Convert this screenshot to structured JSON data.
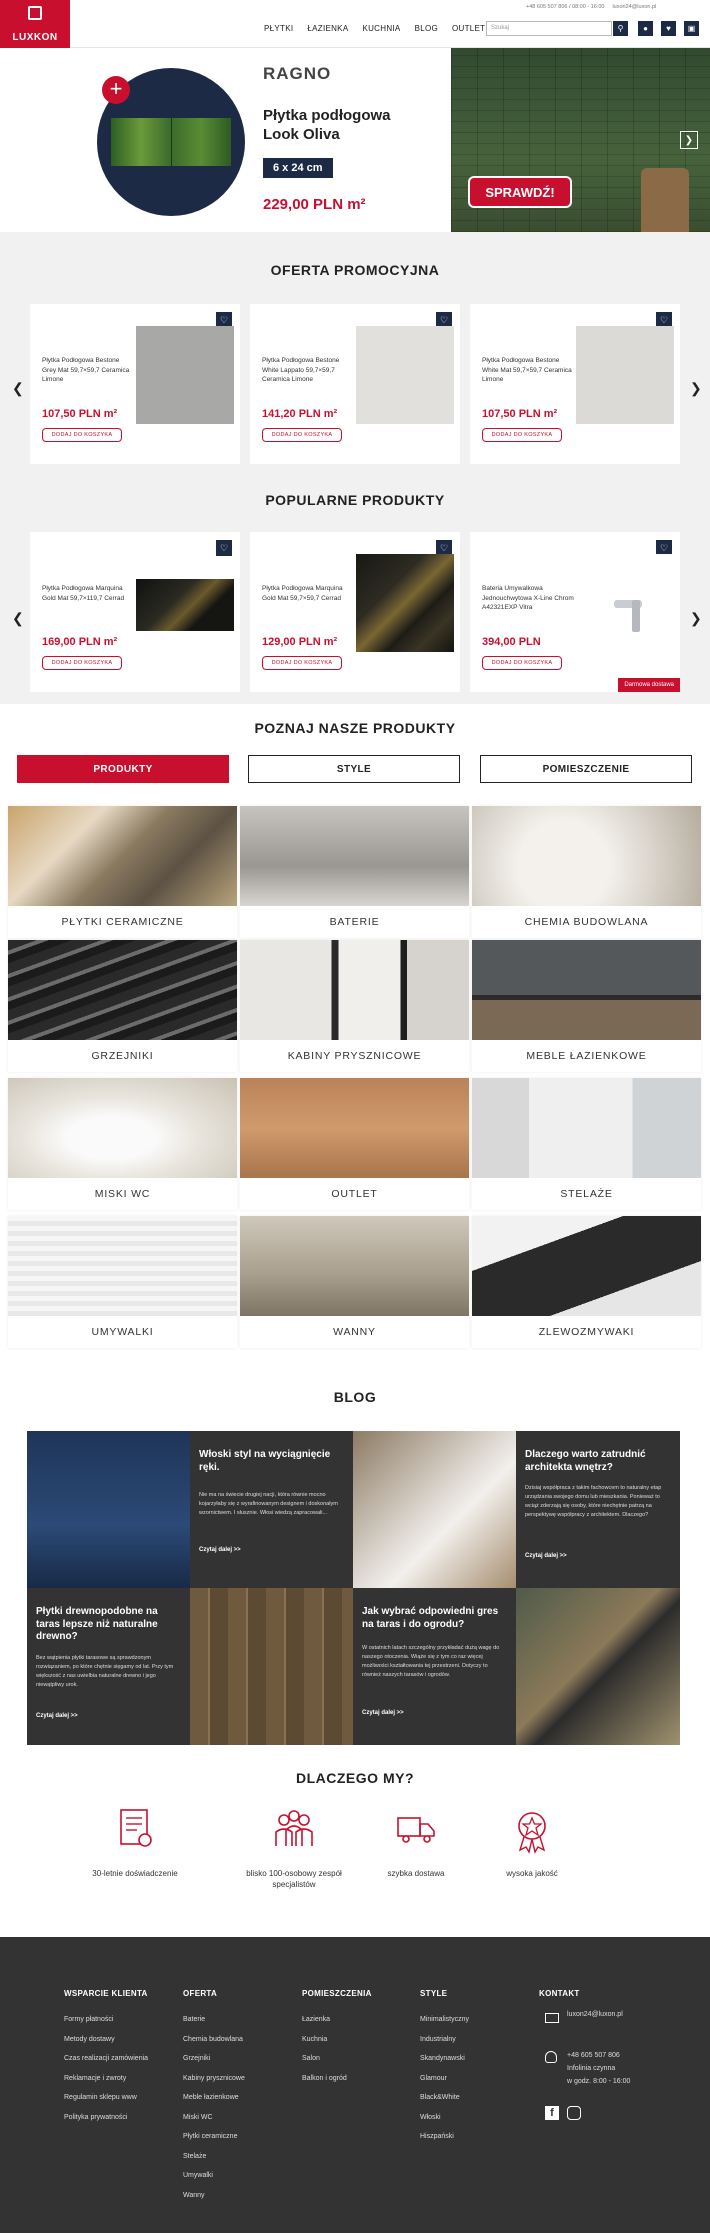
{
  "header": {
    "logo": "LUXKON",
    "nav": [
      "PŁYTKI",
      "ŁAZIENKA",
      "KUCHNIA",
      "BLOG",
      "OUTLET"
    ],
    "contact_phone": "+48 605 507 806 / 08:00 - 16:00",
    "contact_email": "luxon24@luxon.pl",
    "search_placeholder": "Szukaj"
  },
  "hero": {
    "brand": "RAGNO",
    "title": "Płytka podłogowa Look Oliva",
    "size": "6 x 24 cm",
    "price": "229,00 PLN m²",
    "cta": "SPRAWDŹ!"
  },
  "promo": {
    "title": "OFERTA PROMOCYJNA",
    "add_label": "DODAJ DO KOSZYKA",
    "items": [
      {
        "name": "Płytka Podłogowa Bestone Grey Mat 59,7×59,7 Ceramica Limone",
        "price": "107,50 PLN m²"
      },
      {
        "name": "Płytka Podłogowa Bestone White Lappato 59,7×59,7 Ceramica Limone",
        "price": "141,20 PLN m²"
      },
      {
        "name": "Płytka Podłogowa Bestone White Mat 59,7×59,7 Ceramica Limone",
        "price": "107,50 PLN m²"
      }
    ]
  },
  "popular": {
    "title": "POPULARNE PRODUKTY",
    "add_label": "DODAJ DO KOSZYKA",
    "badge": "Darmowa dostawa",
    "items": [
      {
        "name": "Płytka Podłogowa Marquina Gold Mat 59,7×119,7 Cerrad",
        "price": "169,00 PLN m²"
      },
      {
        "name": "Płytka Podłogowa Marquina Gold Mat 59,7×59,7 Cerrad",
        "price": "129,00 PLN m²"
      },
      {
        "name": "Bateria Umywalkowa Jednouchwytowa X-Line Chrom A42321EXP Vitra",
        "price": "394,00 PLN"
      }
    ]
  },
  "know": {
    "title": "POZNAJ NASZE PRODUKTY",
    "tabs": [
      "PRODUKTY",
      "STYLE",
      "POMIESZCZENIE"
    ],
    "categories": [
      "PŁYTKI CERAMICZNE",
      "BATERIE",
      "CHEMIA BUDOWLANA",
      "GRZEJNIKI",
      "KABINY PRYSZNICOWE",
      "MEBLE ŁAZIENKOWE",
      "MISKI WC",
      "OUTLET",
      "STELAŻE",
      "UMYWALKI",
      "WANNY",
      "ZLEWOZMYWAKI"
    ]
  },
  "blog": {
    "title": "BLOG",
    "more": "Czytaj dalej >>",
    "posts": [
      {
        "title": "Włoski styl na wyciągnięcie ręki.",
        "desc": "Nie ma na świecie drugiej nacji, która równie mocno kojarzyłaby się z wyrafinowanym designem i doskonałym wzornictwem. I słusznie. Włosi wiedzą zapracowali..."
      },
      {
        "title": "Dlaczego warto zatrudnić architekta wnętrz?",
        "desc": "Dzisiaj współpraca z takim fachowcem to naturalny etap urządzania swojego domu lub mieszkania. Ponieważ to wciąż zderzają się osoby, które niechętnie patrzą na perspektywę współpracy z architektem. Dlaczego?"
      },
      {
        "title": "Płytki drewnopodobne na taras lepsze niż naturalne drewno?",
        "desc": "Bez wątpienia płytki tarasowe są sprawdzonym rozwiązaniem, po które chętnie sięgamy od lat. Przy tym większość z nas uwielbia naturalne drewno i jego niewątpliwy urok."
      },
      {
        "title": "Jak wybrać odpowiedni gres na taras i do ogrodu?",
        "desc": "W ostatnich latach szczególny przykładać dużą wagę do naszego otoczenia. Wiąże się z tym co raz więcej możliwości kształtowania tej przestrzeni. Dotyczy to również naszych tarasów i ogrodów."
      }
    ]
  },
  "why": {
    "title": "DLACZEGO MY?",
    "items": [
      "30-letnie doświadczenie",
      "blisko 100-osobowy zespół specjalistów",
      "szybka dostawa",
      "wysoka jakość"
    ]
  },
  "footer": {
    "cols": [
      {
        "title": "WSPARCIE KLIENTA",
        "items": [
          "Formy płatności",
          "Metody dostawy",
          "Czas realizacji zamówienia",
          "Reklamacje i zwroty",
          "Regulamin sklepu www",
          "Polityka prywatności"
        ]
      },
      {
        "title": "OFERTA",
        "items": [
          "Baterie",
          "Chemia budowlana",
          "Grzejniki",
          "Kabiny prysznicowe",
          "Meble łazienkowe",
          "Miski WC",
          "Płytki ceramiczne",
          "Stelaże",
          "Umywalki",
          "Wanny"
        ]
      },
      {
        "title": "POMIESZCZENIA",
        "items": [
          "Łazienka",
          "Kuchnia",
          "Salon",
          "Balkon i ogród"
        ]
      },
      {
        "title": "STYLE",
        "items": [
          "Minimalistyczny",
          "Industrialny",
          "Skandynawski",
          "Glamour",
          "Black&White",
          "Włoski",
          "Hiszpański"
        ]
      }
    ],
    "contact_title": "KONTAKT",
    "email": "luxon24@luxon.pl",
    "phone": "+48 605 507 806",
    "hotline": "Infolinia czynna",
    "hours": "w godz. 8:00 - 16:00"
  }
}
